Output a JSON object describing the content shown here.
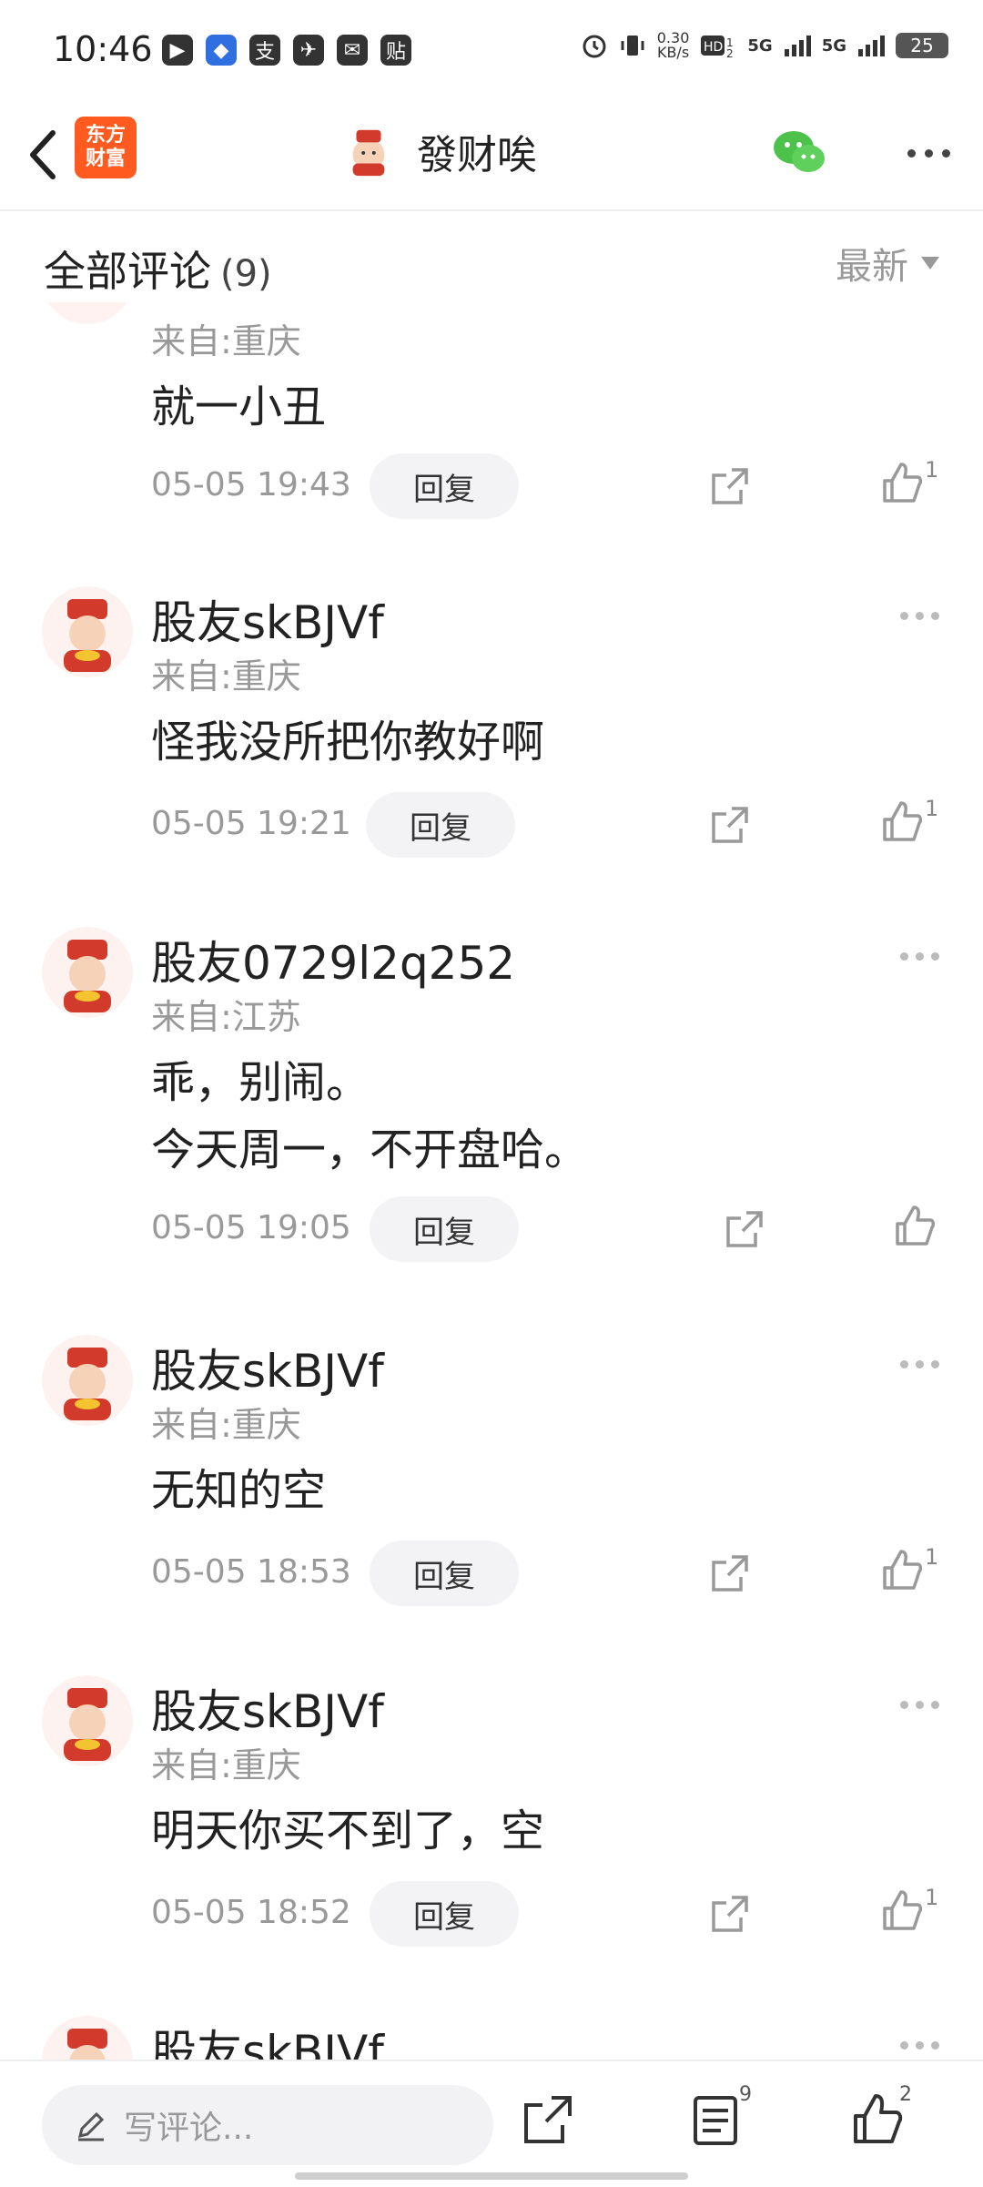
{
  "status_bar": {
    "time": "10:46",
    "app_icons": [
      "▶",
      "◆",
      "支",
      "✈",
      "✉",
      "贴"
    ],
    "speed": "0.30\nKB/s",
    "signal1": "5G",
    "signal2": "5G",
    "battery": "25"
  },
  "header": {
    "brand_line1": "东方",
    "brand_line2": "财富",
    "title": "發财唉"
  },
  "comments": {
    "title": "全部评论",
    "count": "(9)",
    "sort": "最新",
    "items": [
      {
        "name": "",
        "origin": "来自:重庆",
        "content": [
          "就一小丑"
        ],
        "time": "05-05 19:43",
        "reply": "回复",
        "likes": "1"
      },
      {
        "name": "股友skBJVf",
        "origin": "来自:重庆",
        "content": [
          "怪我没所把你教好啊"
        ],
        "time": "05-05 19:21",
        "reply": "回复",
        "likes": "1"
      },
      {
        "name": "股友0729l2q252",
        "origin": "来自:江苏",
        "content": [
          "乖，别闹。",
          "今天周一，不开盘哈。"
        ],
        "time": "05-05 19:05",
        "reply": "回复",
        "likes": ""
      },
      {
        "name": "股友skBJVf",
        "origin": "来自:重庆",
        "content": [
          "无知的空"
        ],
        "time": "05-05 18:53",
        "reply": "回复",
        "likes": "1"
      },
      {
        "name": "股友skBJVf",
        "origin": "来自:重庆",
        "content": [
          "明天你买不到了，空"
        ],
        "time": "05-05 18:52",
        "reply": "回复",
        "likes": "1"
      },
      {
        "name": "股友skBJVf",
        "origin": "",
        "content": [],
        "time": "",
        "reply": "",
        "likes": ""
      }
    ]
  },
  "bottom": {
    "placeholder": "写评论...",
    "comments_count": "9",
    "likes_count": "2"
  }
}
